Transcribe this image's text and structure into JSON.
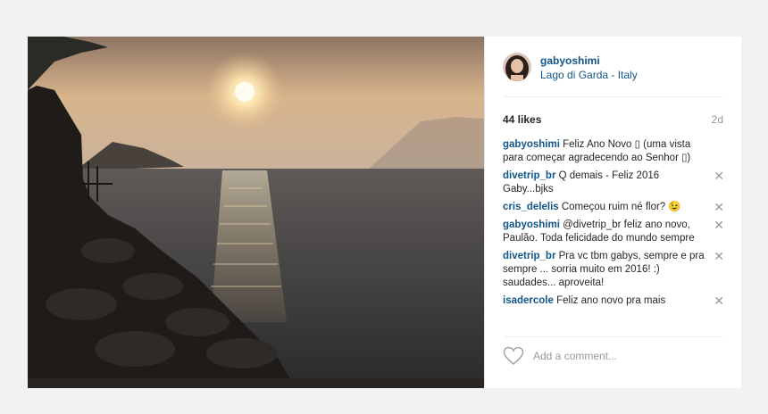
{
  "post": {
    "username": "gabyoshimi",
    "location": "Lago di Garda - Italy",
    "likes": "44 likes",
    "age": "2d"
  },
  "comments": [
    {
      "user": "gabyoshimi",
      "text": "Feliz Ano Novo ▯ (uma vista para começar agradecendo ao Senhor ▯)",
      "deletable": false
    },
    {
      "user": "divetrip_br",
      "text": "Q demais - Feliz 2016 Gaby...bjks",
      "deletable": true
    },
    {
      "user": "cris_delelis",
      "text": "Começou ruim né flor? 😉",
      "deletable": true
    },
    {
      "user": "gabyoshimi",
      "text": "@divetrip_br feliz ano novo, Paulão. Toda felicidade do mundo sempre",
      "deletable": true
    },
    {
      "user": "divetrip_br",
      "text": "Pra vc tbm gabys, sempre e pra sempre ... sorria muito em 2016! :) saudades... aproveita!",
      "deletable": true
    },
    {
      "user": "isadercole",
      "text": "Feliz ano novo pra mais",
      "deletable": true
    }
  ],
  "close_glyph": "✕",
  "add_comment_placeholder": "Add a comment...",
  "colors": {
    "link": "#125688",
    "muted": "#999999"
  }
}
